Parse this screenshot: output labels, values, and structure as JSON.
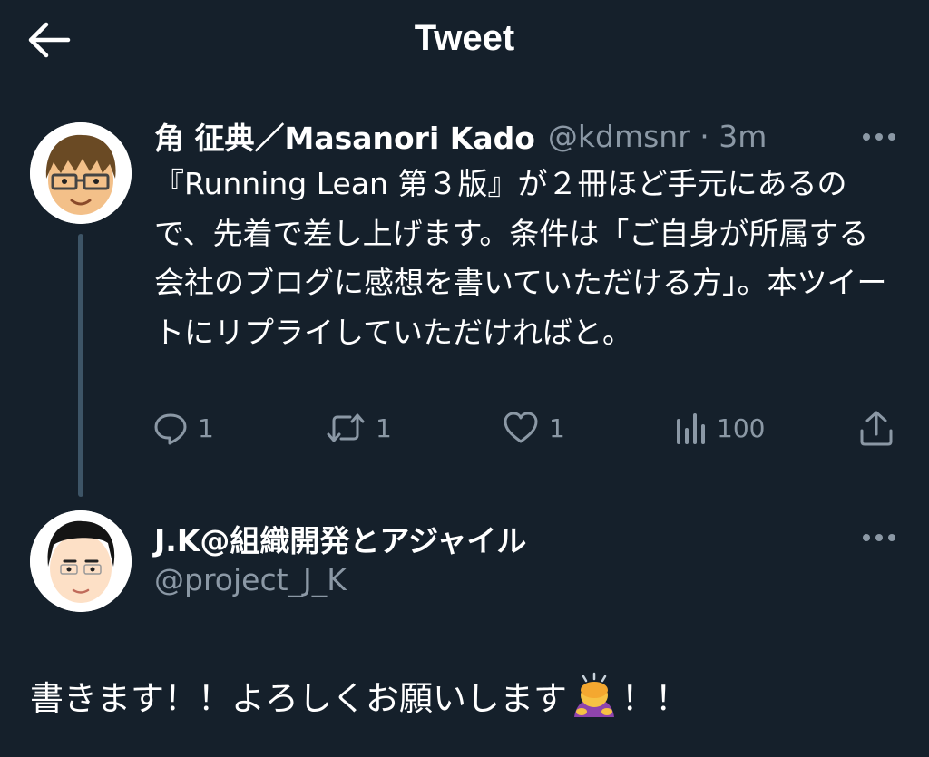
{
  "header": {
    "title": "Tweet",
    "back_icon": "arrow-left-icon"
  },
  "tweet": {
    "display_name": "角 征典／Masanori Kado",
    "handle_time": "@kdmsnr · 3m",
    "text": "『Running Lean 第３版』が２冊ほど手元にあるので、先着で差し上げます。条件は「ご自身が所属する会社のブログに感想を書いていただける方」。本ツイートにリプライしていただければと。",
    "actions": {
      "reply_count": "1",
      "retweet_count": "1",
      "like_count": "1",
      "views_count": "100"
    }
  },
  "reply": {
    "display_name": "J.K@組織開発とアジャイル",
    "handle": "@project_J_K",
    "text_before": "書きます！！よろしくお願いします",
    "emoji": "person-bowing-emoji",
    "text_after": "！！"
  },
  "colors": {
    "background": "#15202b",
    "text_primary": "#ffffff",
    "text_secondary": "#8b98a5",
    "thread_line": "#3d5466"
  }
}
